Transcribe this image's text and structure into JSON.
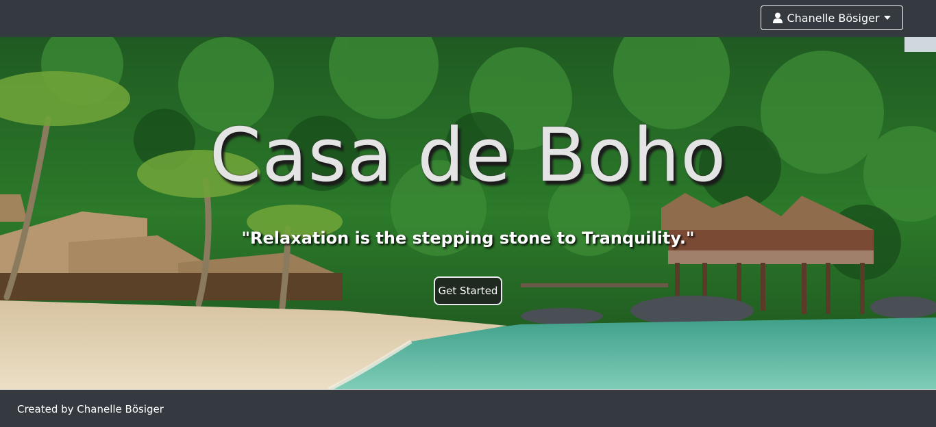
{
  "header": {
    "user_name": "Chanelle Bösiger",
    "user_icon": "user-icon",
    "dropdown_icon": "caret-down-icon"
  },
  "hero": {
    "title": "Casa de Boho",
    "quote": "\"Relaxation is the stepping stone to Tranquility.\"",
    "cta_label": "Get Started",
    "background": "tropical beach resort photo"
  },
  "footer": {
    "credit": "Created by Chanelle Bösiger"
  },
  "colors": {
    "navbar": "#343a40",
    "jungle": "#2f6b2b",
    "sand": "#e2d2b3",
    "water": "#5fb8a2"
  }
}
